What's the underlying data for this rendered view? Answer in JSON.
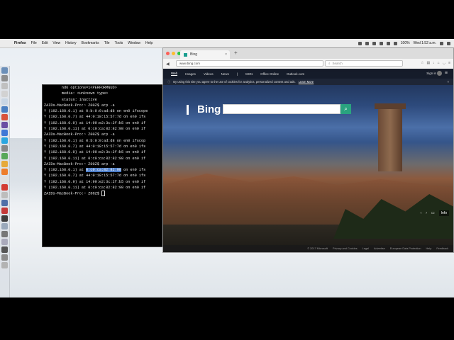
{
  "menubar": {
    "app": "Firefox",
    "items": [
      "File",
      "Edit",
      "View",
      "History",
      "Bookmarks",
      "Tile",
      "Tools",
      "Window",
      "Help"
    ],
    "battery": "100%",
    "clock": "Wed 1:52 a.m."
  },
  "terminal": {
    "lines": [
      "        nd6 options=1<PERFORMNUD>",
      "        media: <unknown type>",
      "        status: inactive",
      "ZAIDs-MacBook-Pro:~ Z00Z$ arp -a",
      "? (192.168.0.1) at 0:b:0:0:ad:d8 on en0 ifscope",
      "? (192.168.0.7) at 44:0:18:15:57:7d on en0 ifs",
      "? (192.168.0.9) at 14:99:e2:3c:2f:b5 on en0 if",
      "? (192.168.0.11) at 0:c0:ca:82:82:98 on en0 if",
      "ZAIDs-MacBook-Pro:~ Z00Z$ arp -a",
      "? (192.168.0.1) at 0:b:0:0:ad:d8 on en0 ifscop",
      "? (192.168.0.7) at 44:0:18:15:57:7d on en0 ifs",
      "? (192.168.0.9) at 14:99:e2:3c:2f:b5 on en0 if",
      "? (192.168.0.11) at 0:c0:ca:82:82:98 on en0 if",
      "ZAIDs-MacBook-Pro:~ Z00Z$ arp -a"
    ],
    "hl_line_prefix": "? (192.168.0.1) at ",
    "hl_text": "0:c0:ca:82:82:98",
    "hl_line_suffix": " on en0 ifs",
    "after_lines": [
      "? (192.168.0.7) at 44:0:18:15:57:7d on en0 ifs",
      "? (192.168.0.9) at 14:99:e2:3c:2f:b5 on en0 if",
      "? (192.168.0.11) at 0:c0:ca:82:82:98 on en0 if"
    ],
    "prompt": "ZAIDs-MacBook-Pro:~ Z00Z$ "
  },
  "browser": {
    "tab_title": "Bing",
    "new_tab": "+",
    "url": "www.bing.com",
    "search_placeholder": "Search",
    "nav": {
      "items": [
        "Web",
        "Images",
        "Videos",
        "News",
        "MSN",
        "Office Online",
        "Outlook.com"
      ],
      "sign_in": "Sign in"
    },
    "cookie_notice": "By using this site you agree to the use of cookies for analytics, personalized content and ads.",
    "cookie_link": "Learn More",
    "logo": "Bing",
    "carousel_info": "Info",
    "footer": [
      "© 2017 Microsoft",
      "Privacy and Cookies",
      "Legal",
      "Advertise",
      "European Data Protection",
      "Help",
      "Feedback"
    ]
  },
  "colors": {
    "bing_search_button": "#2aa37f",
    "terminal_selection": "#4b7cc7"
  }
}
